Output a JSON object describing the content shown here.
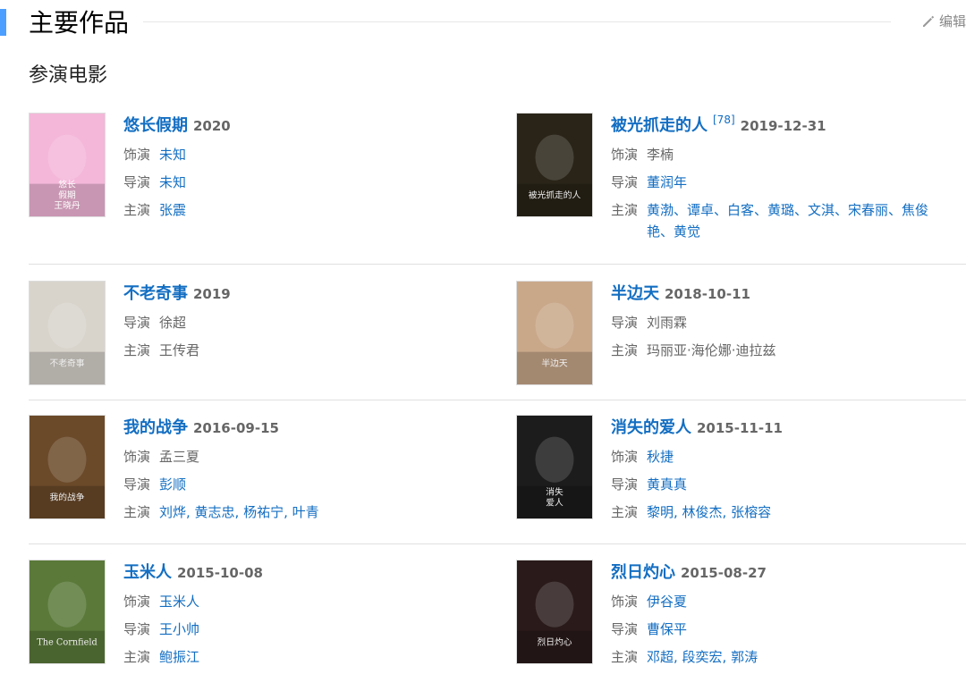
{
  "section": {
    "title": "主要作品",
    "edit_label": "编辑"
  },
  "subsection": {
    "title": "参演电影"
  },
  "movies": [
    {
      "title": "悠长假期",
      "ref": "",
      "date": "2020",
      "fields": [
        {
          "label": "饰演",
          "value": "未知",
          "link": true
        },
        {
          "label": "导演",
          "value": "未知",
          "link": true
        },
        {
          "label": "主演",
          "value": "张震",
          "link": true
        }
      ],
      "poster_text": [
        "悠长",
        "假期",
        "王晓丹"
      ],
      "poster_color": "#f4b7d9"
    },
    {
      "title": "被光抓走的人",
      "ref": "[78]",
      "date": "2019-12-31",
      "fields": [
        {
          "label": "饰演",
          "value": "李楠",
          "link": false
        },
        {
          "label": "导演",
          "value": "董润年",
          "link": true
        },
        {
          "label": "主演",
          "value": "黄渤、谭卓、白客、黄璐、文淇、宋春丽、焦俊艳、黄觉",
          "link": true
        }
      ],
      "poster_text": [
        "被光抓走的人"
      ],
      "poster_color": "#2a2418"
    },
    {
      "title": "不老奇事",
      "ref": "",
      "date": "2019",
      "fields": [
        {
          "label": "导演",
          "value": "徐超",
          "link": false
        },
        {
          "label": "主演",
          "value": "王传君",
          "link": false
        }
      ],
      "poster_text": [
        "不老奇事"
      ],
      "poster_color": "#d8d4cc"
    },
    {
      "title": "半边天",
      "ref": "",
      "date": "2018-10-11",
      "fields": [
        {
          "label": "导演",
          "value": "刘雨霖",
          "link": false
        },
        {
          "label": "主演",
          "value": "玛丽亚·海伦娜·迪拉兹",
          "link": false
        }
      ],
      "poster_text": [
        "半边天"
      ],
      "poster_color": "#c9a88a"
    },
    {
      "title": "我的战争",
      "ref": "",
      "date": "2016-09-15",
      "fields": [
        {
          "label": "饰演",
          "value": "孟三夏",
          "link": false
        },
        {
          "label": "导演",
          "value": "彭顺",
          "link": true
        },
        {
          "label": "主演",
          "value": "刘烨, 黄志忠, 杨祐宁, 叶青",
          "link": true
        }
      ],
      "poster_text": [
        "我的战争"
      ],
      "poster_color": "#6b4a2a"
    },
    {
      "title": "消失的爱人",
      "ref": "",
      "date": "2015-11-11",
      "fields": [
        {
          "label": "饰演",
          "value": "秋捷",
          "link": true
        },
        {
          "label": "导演",
          "value": "黄真真",
          "link": true
        },
        {
          "label": "主演",
          "value": "黎明, 林俊杰, 张榕容",
          "link": true
        }
      ],
      "poster_text": [
        "消失",
        "爱人"
      ],
      "poster_color": "#1c1c1c"
    },
    {
      "title": "玉米人",
      "ref": "",
      "date": "2015-10-08",
      "fields": [
        {
          "label": "饰演",
          "value": "玉米人",
          "link": true
        },
        {
          "label": "导演",
          "value": "王小帅",
          "link": true
        },
        {
          "label": "主演",
          "value": "鲍振江",
          "link": true
        }
      ],
      "poster_text": [
        "The Cornfield"
      ],
      "poster_color": "#5b7a3a"
    },
    {
      "title": "烈日灼心",
      "ref": "",
      "date": "2015-08-27",
      "fields": [
        {
          "label": "饰演",
          "value": "伊谷夏",
          "link": true
        },
        {
          "label": "导演",
          "value": "曹保平",
          "link": true
        },
        {
          "label": "主演",
          "value": "邓超, 段奕宏, 郭涛",
          "link": true
        }
      ],
      "poster_text": [
        "烈日灼心"
      ],
      "poster_color": "#2a1a1a"
    }
  ]
}
